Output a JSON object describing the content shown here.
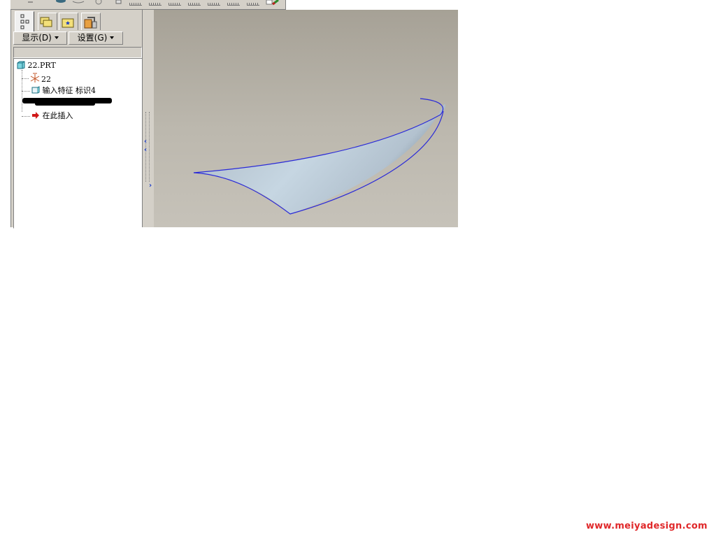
{
  "toolbar": {
    "icons": [
      "arrow-icon",
      "eye-icon",
      "view-icon",
      "orient-icon",
      "layer-icon",
      "ruler-icon",
      "ruler-icon",
      "ruler-icon",
      "ruler-icon",
      "ruler-icon",
      "ruler-icon",
      "ruler-icon",
      "pencil-icon"
    ]
  },
  "navigator": {
    "tabs": [
      "model-tree-icon",
      "folder-browser-icon",
      "favorites-icon",
      "connections-icon"
    ],
    "active_tab": 0,
    "show_menu": "显示(D)",
    "settings_menu": "设置(G)"
  },
  "tree": {
    "root": "22.PRT",
    "items": [
      {
        "label": "22",
        "icon": "csys-icon"
      },
      {
        "label": "输入特征 标识4",
        "icon": "import-feature-icon"
      },
      {
        "label": "",
        "icon": "redacted"
      },
      {
        "label": "在此插入",
        "icon": "insert-arrow-icon"
      }
    ]
  },
  "colors": {
    "surface_edge": "#2a2ad8",
    "viewport_top": "#a6a196",
    "viewport_bottom": "#c6c2b9",
    "watermark": "#e0282a"
  },
  "watermark": "www.meiyadesign.com"
}
